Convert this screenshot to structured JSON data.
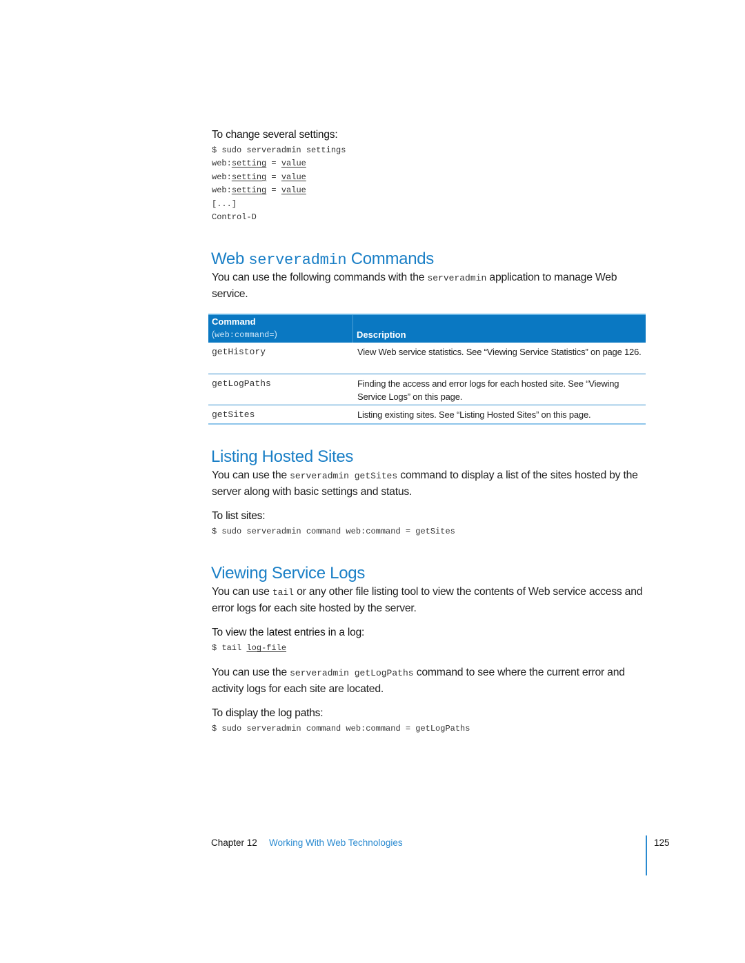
{
  "section_settings": {
    "task_heading": "To change several settings:",
    "code_lines": [
      [
        {
          "t": "$ sudo serveradmin settings",
          "u": false
        }
      ],
      [
        {
          "t": "web:",
          "u": false
        },
        {
          "t": "setting",
          "u": true
        },
        {
          "t": " = ",
          "u": false
        },
        {
          "t": "value",
          "u": true
        }
      ],
      [
        {
          "t": "web:",
          "u": false
        },
        {
          "t": "setting",
          "u": true
        },
        {
          "t": " = ",
          "u": false
        },
        {
          "t": "value",
          "u": true
        }
      ],
      [
        {
          "t": "web:",
          "u": false
        },
        {
          "t": "setting",
          "u": true
        },
        {
          "t": " = ",
          "u": false
        },
        {
          "t": "value",
          "u": true
        }
      ],
      [
        {
          "t": "[...]",
          "u": false
        }
      ],
      [
        {
          "t": "Control-D",
          "u": false
        }
      ]
    ]
  },
  "section_commands": {
    "heading_pre": "Web ",
    "heading_code": "serveradmin",
    "heading_post": " Commands",
    "intro_pre": "You can use the following commands with the ",
    "intro_code": "serveradmin",
    "intro_post": " application to manage Web service.",
    "table": {
      "header_col1_title": "Command",
      "header_col1_sub_open": "(",
      "header_col1_sub_code": "web:command=",
      "header_col1_sub_close": ")",
      "header_col2_title": "Description",
      "rows": [
        {
          "command": "getHistory",
          "description": "View Web service statistics. See “Viewing Service Statistics” on page 126."
        },
        {
          "command": "getLogPaths",
          "description": "Finding the access and error logs for each hosted site. See “Viewing Service Logs” on this page."
        },
        {
          "command": "getSites",
          "description": "Listing existing sites. See “Listing Hosted Sites” on this page."
        }
      ]
    }
  },
  "section_listing": {
    "heading": "Listing Hosted Sites",
    "intro_pre": "You can use the ",
    "intro_code": "serveradmin getSites",
    "intro_post": " command to display a list of the sites hosted by the server along with basic settings and status.",
    "task_heading": "To list sites:",
    "code": "$ sudo serveradmin command web:command = getSites"
  },
  "section_logs": {
    "heading": "Viewing Service Logs",
    "intro_pre": "You can use ",
    "intro_code": "tail",
    "intro_post": " or any other file listing tool to view the contents of Web service access and error logs for each site hosted by the server.",
    "task_heading": "To view the latest entries in a log:",
    "code_prefix": "$ tail ",
    "code_arg": "log-file",
    "para2_pre": "You can use the ",
    "para2_code": "serveradmin getLogPaths",
    "para2_post": " command to see where the current error and activity logs for each site are located.",
    "task_heading2": "To display the log paths:",
    "code2": "$ sudo serveradmin command web:command = getLogPaths"
  },
  "footer": {
    "chapter_label": "Chapter 12",
    "chapter_title": "Working With Web Technologies",
    "page_number": "125"
  },
  "colors": {
    "heading_blue": "#1a7fc6",
    "table_header_bg": "#0a78c2",
    "table_rule": "#2e8ccc"
  }
}
